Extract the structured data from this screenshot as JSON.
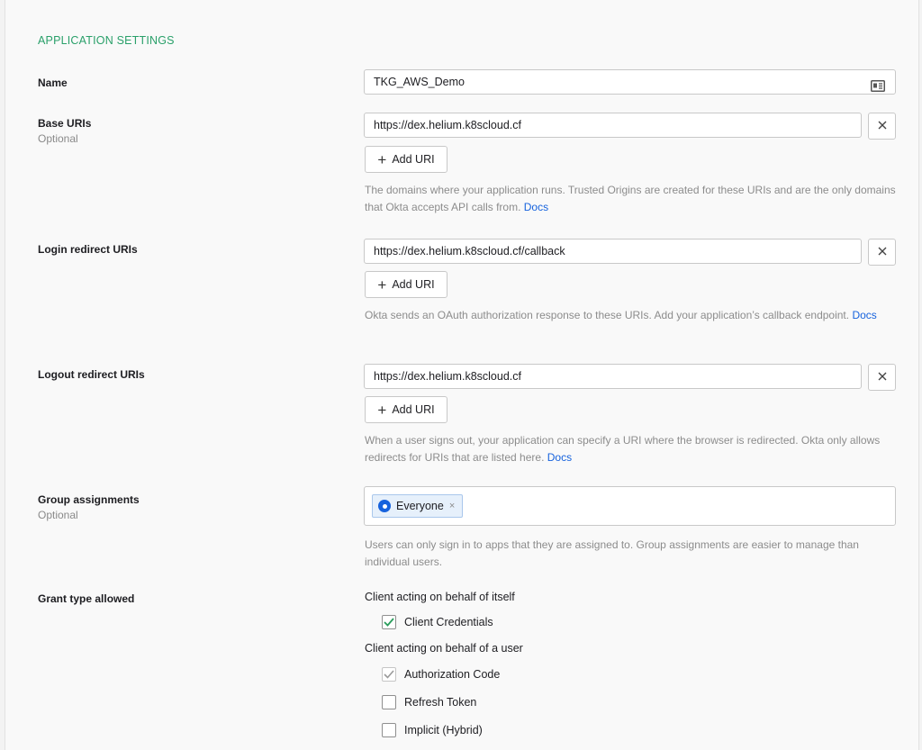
{
  "section_title": "APPLICATION SETTINGS",
  "name": {
    "label": "Name",
    "value": "TKG_AWS_Demo"
  },
  "base_uris": {
    "label": "Base URIs",
    "sublabel": "Optional",
    "value": "https://dex.helium.k8scloud.cf",
    "add_label": "Add URI",
    "help": "The domains where your application runs. Trusted Origins are created for these URIs and are the only domains that Okta accepts API calls from.",
    "docs": "Docs"
  },
  "login_redirect": {
    "label": "Login redirect URIs",
    "value": "https://dex.helium.k8scloud.cf/callback",
    "add_label": "Add URI",
    "help": "Okta sends an OAuth authorization response to these URIs. Add your application’s callback endpoint.",
    "docs": "Docs"
  },
  "logout_redirect": {
    "label": "Logout redirect URIs",
    "value": "https://dex.helium.k8scloud.cf",
    "add_label": "Add URI",
    "help": "When a user signs out, your application can specify a URI where the browser is redirected. Okta only allows redirects for URIs that are listed here.",
    "docs": "Docs"
  },
  "group_assignments": {
    "label": "Group assignments",
    "sublabel": "Optional",
    "chip": "Everyone",
    "chip_remove": "×",
    "help": "Users can only sign in to apps that they are assigned to. Group assignments are easier to manage than individual users."
  },
  "grant_type": {
    "label": "Grant type allowed",
    "self_heading": "Client acting on behalf of itself",
    "client_credentials": "Client Credentials",
    "user_heading": "Client acting on behalf of a user",
    "authorization_code": "Authorization Code",
    "refresh_token": "Refresh Token",
    "implicit": "Implicit (Hybrid)"
  },
  "colors": {
    "accent": "#2aa06a",
    "link": "#1662dd",
    "check_green": "#2a9d5c"
  },
  "icons": {
    "remove": "close-icon",
    "add": "plus-icon",
    "card": "id-card-icon",
    "check": "checkmark-icon"
  }
}
